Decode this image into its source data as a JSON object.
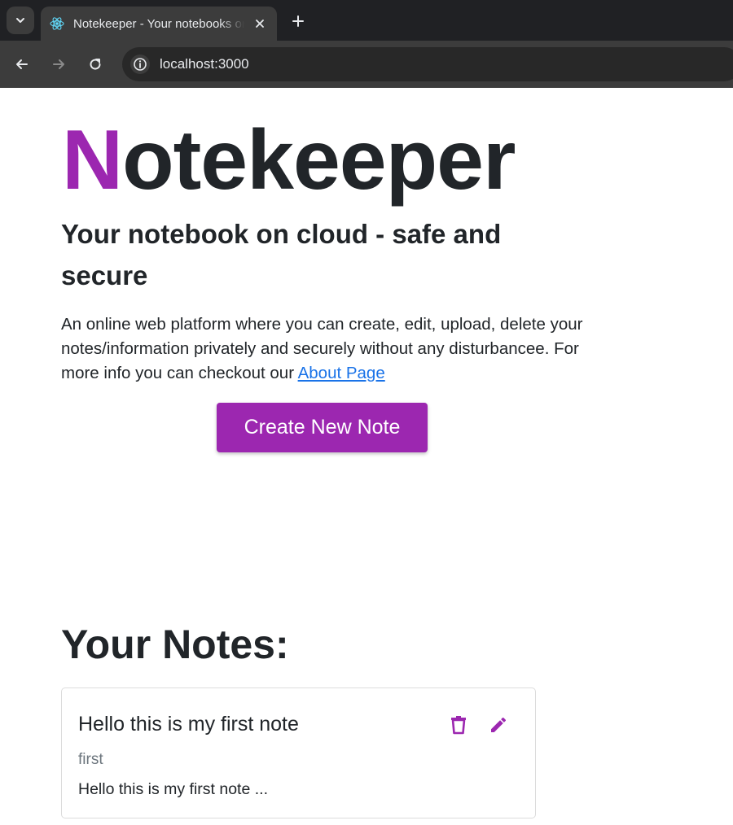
{
  "browser": {
    "tab_title": "Notekeeper - Your notebooks on cloud",
    "url": "localhost:3000"
  },
  "page": {
    "brand_first_letter": "N",
    "brand_rest": "otekeeper",
    "subtitle": "Your notebook on cloud - safe and secure",
    "description": "An online web platform where you can create, edit, upload, delete your notes/information privately and securely without any disturbancee. For more info you can checkout our ",
    "about_link": "About Page",
    "create_button": "Create New Note",
    "notes_heading": "Your Notes:"
  },
  "notes": [
    {
      "title": "Hello this is my first note",
      "tag": "first",
      "description": "Hello this is my first note ..."
    }
  ],
  "colors": {
    "accent": "#9c27b0",
    "text": "#212529",
    "link": "#1a73e8"
  },
  "icons": {
    "delete": "trash-icon",
    "edit": "pencil-icon"
  }
}
